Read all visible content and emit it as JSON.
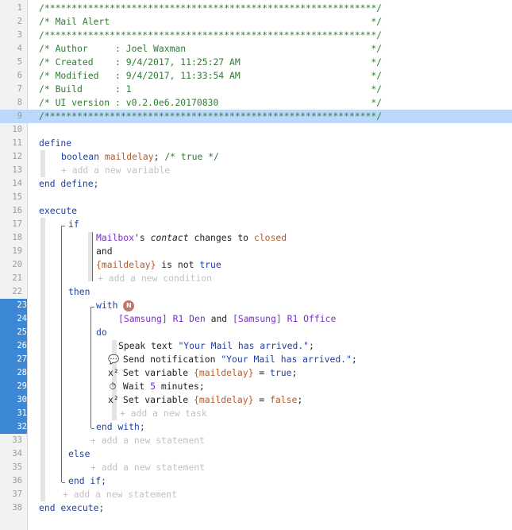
{
  "editor": {
    "highlighted_line": 9,
    "selected_lines": [
      23,
      24,
      25,
      26,
      27,
      28,
      29,
      30,
      31,
      32
    ],
    "lines": [
      {
        "n": "1",
        "text": "/*************************************************************/"
      },
      {
        "n": "2",
        "text": "/* Mail Alert                                                */"
      },
      {
        "n": "3",
        "text": "/*************************************************************/"
      },
      {
        "n": "4",
        "text": "/* Author     : Joel Waxman                                  */"
      },
      {
        "n": "5",
        "text": "/* Created    : 9/4/2017, 11:25:27 AM                        */"
      },
      {
        "n": "6",
        "text": "/* Modified   : 9/4/2017, 11:33:54 AM                        */"
      },
      {
        "n": "7",
        "text": "/* Build      : 1                                            */"
      },
      {
        "n": "8",
        "text": "/* UI version : v0.2.0e6.20170830                            */"
      },
      {
        "n": "9",
        "text": "/*************************************************************/"
      },
      {
        "n": "10"
      },
      {
        "n": "11",
        "kw": "define"
      },
      {
        "n": "12",
        "kw": "boolean",
        "var": "maildelay",
        "rest": ";",
        "cm": "/* true */"
      },
      {
        "n": "13",
        "add": "+ add a new variable"
      },
      {
        "n": "14",
        "kw": "end define;"
      },
      {
        "n": "15"
      },
      {
        "n": "16",
        "kw": "execute"
      },
      {
        "n": "17",
        "kw": "if"
      },
      {
        "n": "18",
        "dev": "Mailbox",
        "t1": "'s ",
        "it": "contact",
        "t2": " changes to ",
        "var": "closed"
      },
      {
        "n": "19",
        "text": "and"
      },
      {
        "n": "20",
        "var": "{maildelay}",
        "t1": " is not ",
        "kw": "true"
      },
      {
        "n": "21",
        "add": "+ add a new condition"
      },
      {
        "n": "22",
        "kw": "then"
      },
      {
        "n": "23",
        "kw": "with",
        "badge": "N"
      },
      {
        "n": "24",
        "dev1": "[Samsung] R1 Den",
        "t1": " and ",
        "dev2": "[Samsung] R1 Office"
      },
      {
        "n": "25",
        "kw": "do"
      },
      {
        "n": "26",
        "t1": "Speak text ",
        "str": "\"Your Mail has arrived.\"",
        "t2": ";"
      },
      {
        "n": "27",
        "glyph": "💬",
        "t1": " Send notification ",
        "str": "\"Your Mail has arrived.\"",
        "t2": ";"
      },
      {
        "n": "28",
        "glyph": "x²",
        "t1": " Set variable ",
        "var": "{maildelay}",
        "t2": " = ",
        "kw": "true",
        "t3": ";"
      },
      {
        "n": "29",
        "glyph": "⏱",
        "t1": " Wait ",
        "num": "5",
        "t2": " minutes;"
      },
      {
        "n": "30",
        "glyph": "x²",
        "t1": " Set variable ",
        "var": "{maildelay}",
        "t2": " = ",
        "kw": "false",
        "t3": ";"
      },
      {
        "n": "31",
        "add": "+ add a new task"
      },
      {
        "n": "32",
        "kw": "end with;"
      },
      {
        "n": "33",
        "add": "+ add a new statement"
      },
      {
        "n": "34",
        "kw": "else"
      },
      {
        "n": "35",
        "add": "+ add a new statement"
      },
      {
        "n": "36",
        "kw": "end if;"
      },
      {
        "n": "37",
        "add": "+ add a new statement"
      },
      {
        "n": "38",
        "kw": "end execute;"
      }
    ]
  }
}
